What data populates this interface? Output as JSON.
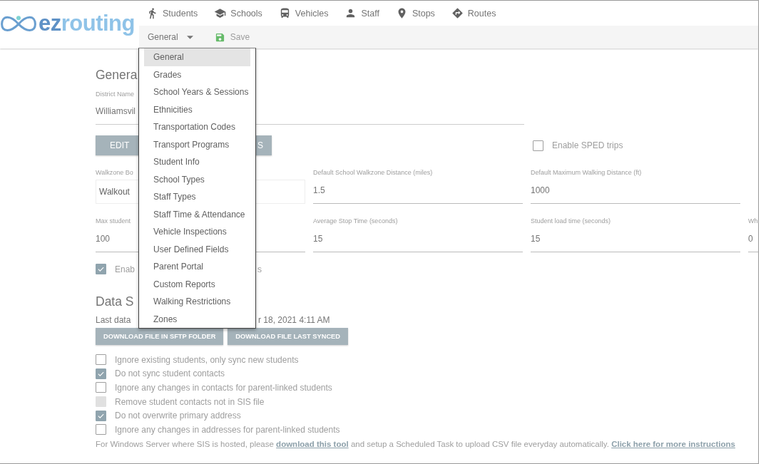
{
  "logo": {
    "text_1": "ez",
    "text_2": "routing"
  },
  "nav": [
    {
      "label": "Students"
    },
    {
      "label": "Schools"
    },
    {
      "label": "Vehicles"
    },
    {
      "label": "Staff"
    },
    {
      "label": "Stops"
    },
    {
      "label": "Routes"
    }
  ],
  "toolbar": {
    "section": "General",
    "save": "Save"
  },
  "menu": [
    {
      "label": "General",
      "selected": true
    },
    {
      "label": "Grades",
      "selected": false
    },
    {
      "label": "School Years & Sessions",
      "selected": false
    },
    {
      "label": "Ethnicities",
      "selected": false
    },
    {
      "label": "Transportation Codes",
      "selected": false
    },
    {
      "label": "Transport Programs",
      "selected": false
    },
    {
      "label": "Student Info",
      "selected": false
    },
    {
      "label": "School Types",
      "selected": false
    },
    {
      "label": "Staff Types",
      "selected": false
    },
    {
      "label": "Staff Time & Attendance",
      "selected": false
    },
    {
      "label": "Vehicle Inspections",
      "selected": false
    },
    {
      "label": "User Defined Fields",
      "selected": false
    },
    {
      "label": "Parent Portal",
      "selected": false
    },
    {
      "label": "Custom Reports",
      "selected": false
    },
    {
      "label": "Walking Restrictions",
      "selected": false
    },
    {
      "label": "Zones",
      "selected": false
    }
  ],
  "general": {
    "title": "Genera",
    "district_label": "District Name",
    "district_value": "Williamsvil",
    "edit_button": {
      "label_start": "EDIT",
      "label_end": "S"
    },
    "sped": {
      "label": "Enable SPED trips",
      "checked": false
    },
    "rows": [
      [
        {
          "kind": "select",
          "label": "Walkzone Bo",
          "value": "Walkout"
        },
        {
          "kind": "text",
          "label": "Default School Walkzone Distance (miles)",
          "value": "1.5"
        },
        {
          "kind": "text",
          "label": "Default Maximum Walking Distance (ft)",
          "value": "1000"
        }
      ],
      [
        {
          "kind": "text",
          "label": "Max student",
          "value": "100"
        },
        {
          "kind": "text",
          "label": "Average Stop Time (seconds)",
          "value": "15"
        },
        {
          "kind": "text",
          "label": "Student load time (seconds)",
          "value": "15"
        },
        {
          "kind": "text",
          "label": "Wh",
          "value": "0"
        }
      ]
    ],
    "enable": {
      "label_start": "Enab",
      "label_end": "s",
      "checked": true
    }
  },
  "data_sync": {
    "title": "Data S",
    "last_start": "Last data",
    "last_end": "r 18, 2021 4:11 AM",
    "buttons": [
      "DOWNLOAD FILE IN SFTP FOLDER",
      "DOWNLOAD FILE LAST SYNCED"
    ],
    "options": [
      {
        "label": "Ignore existing students, only sync new students",
        "checked": false,
        "disabled": false
      },
      {
        "label": "Do not sync student contacts",
        "checked": true,
        "disabled": false
      },
      {
        "label": "Ignore any changes in contacts for parent-linked students",
        "checked": false,
        "disabled": false
      },
      {
        "label": "Remove student contacts not in SIS file",
        "checked": false,
        "disabled": true
      },
      {
        "label": "Do not overwrite primary address",
        "checked": true,
        "disabled": false
      },
      {
        "label": "Ignore any changes in addresses for parent-linked students",
        "checked": false,
        "disabled": false
      }
    ],
    "footer": {
      "text_1": "For Windows Server where SIS is hosted, please ",
      "link_1": "download this tool",
      "text_2": " and setup a Scheduled Task to upload CSV file everyday automatically. ",
      "link_2": "Click here for more instructions"
    }
  }
}
